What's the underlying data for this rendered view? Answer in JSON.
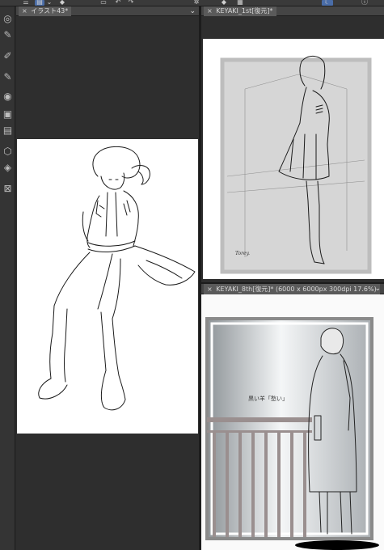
{
  "toolbar": {
    "icons": [
      "menu-icon",
      "layers-icon",
      "chevron-down-icon",
      "fill-icon",
      "folder-icon",
      "undo-icon",
      "redo-icon",
      "settings-icon",
      "transform-icon",
      "ruler-icon",
      "moon-icon",
      "info-icon"
    ]
  },
  "left_tools": [
    "navigator-icon",
    "pen-pressure-icon",
    "brush-settings-icon",
    "brush-size-icon",
    "color-circle-icon",
    "layer-property-icon",
    "canvas-icon",
    "3d-box-icon",
    "layers-stack-icon",
    "reference-icon"
  ],
  "panels": {
    "left": {
      "tab_title": "イラスト43*",
      "close_glyph": "×"
    },
    "top_right": {
      "tab_title": "KEYAKI_1st[復元]*",
      "close_glyph": "×",
      "signature": "Torey."
    },
    "bottom_right": {
      "tab_title": "KEYAKI_8th[復元]* (6000 x 6000px 300dpi 17.6%)",
      "close_glyph": "×",
      "caption": "黒い羊「愁い」"
    }
  },
  "colors": {
    "accent": "#4a6da8",
    "panel_bg": "#2d2d2d",
    "tab_bg": "#454545"
  }
}
